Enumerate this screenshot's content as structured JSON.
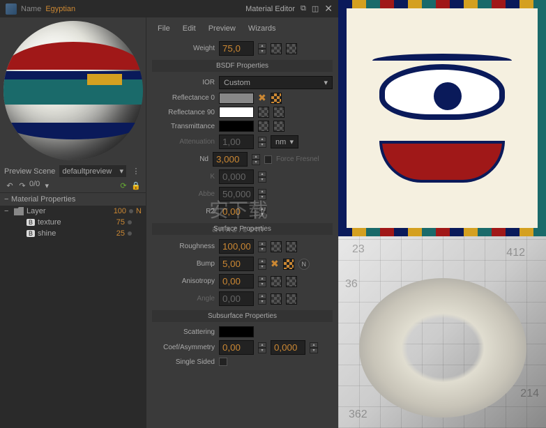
{
  "titlebar": {
    "title": "Material Editor",
    "name_label": "Name",
    "name_value": "Egyptian"
  },
  "menu": {
    "file": "File",
    "edit": "Edit",
    "preview": "Preview",
    "wizards": "Wizards"
  },
  "scene": {
    "label": "Preview Scene",
    "value": "defaultpreview",
    "counter": "0/0"
  },
  "tree": {
    "header": "Material Properties",
    "layer": {
      "label": "Layer",
      "value": "100",
      "flag": "N"
    },
    "texture": {
      "badge": "B",
      "label": "texture",
      "value": "75"
    },
    "shine": {
      "badge": "B",
      "label": "shine",
      "value": "25"
    }
  },
  "props": {
    "weight": {
      "label": "Weight",
      "value": "75,0"
    },
    "bsdf_header": "BSDF Properties",
    "ior": {
      "label": "IOR",
      "value": "Custom"
    },
    "reflectance0": {
      "label": "Reflectance 0"
    },
    "reflectance90": {
      "label": "Reflectance 90"
    },
    "transmittance": {
      "label": "Transmittance"
    },
    "attenuation": {
      "label": "Attenuation",
      "value": "1,00",
      "unit": "nm"
    },
    "nd": {
      "label": "Nd",
      "value": "3,000"
    },
    "force_fresnel": "Force Fresnel",
    "k": {
      "label": "K",
      "value": "0,000"
    },
    "abbe": {
      "label": "Abbe",
      "value": "50,000"
    },
    "r2": {
      "label": "R2",
      "value": "0,00"
    },
    "surface_header": "Surface Properties",
    "roughness": {
      "label": "Roughness",
      "value": "100,00"
    },
    "bump": {
      "label": "Bump",
      "value": "5,00"
    },
    "anisotropy": {
      "label": "Anisotropy",
      "value": "0,00"
    },
    "angle": {
      "label": "Angle",
      "value": "0,00"
    },
    "subsurface_header": "Subsurface Properties",
    "scattering": {
      "label": "Scattering"
    },
    "coef_asym": {
      "label": "Coef/Asymmetry",
      "value1": "0,00",
      "value2": "0,000"
    },
    "single_sided": {
      "label": "Single Sided"
    }
  },
  "grid_nums": [
    "23",
    "412",
    "36",
    "214",
    "362"
  ],
  "watermark": {
    "main": "安下载",
    "sub": "anxz.com"
  }
}
